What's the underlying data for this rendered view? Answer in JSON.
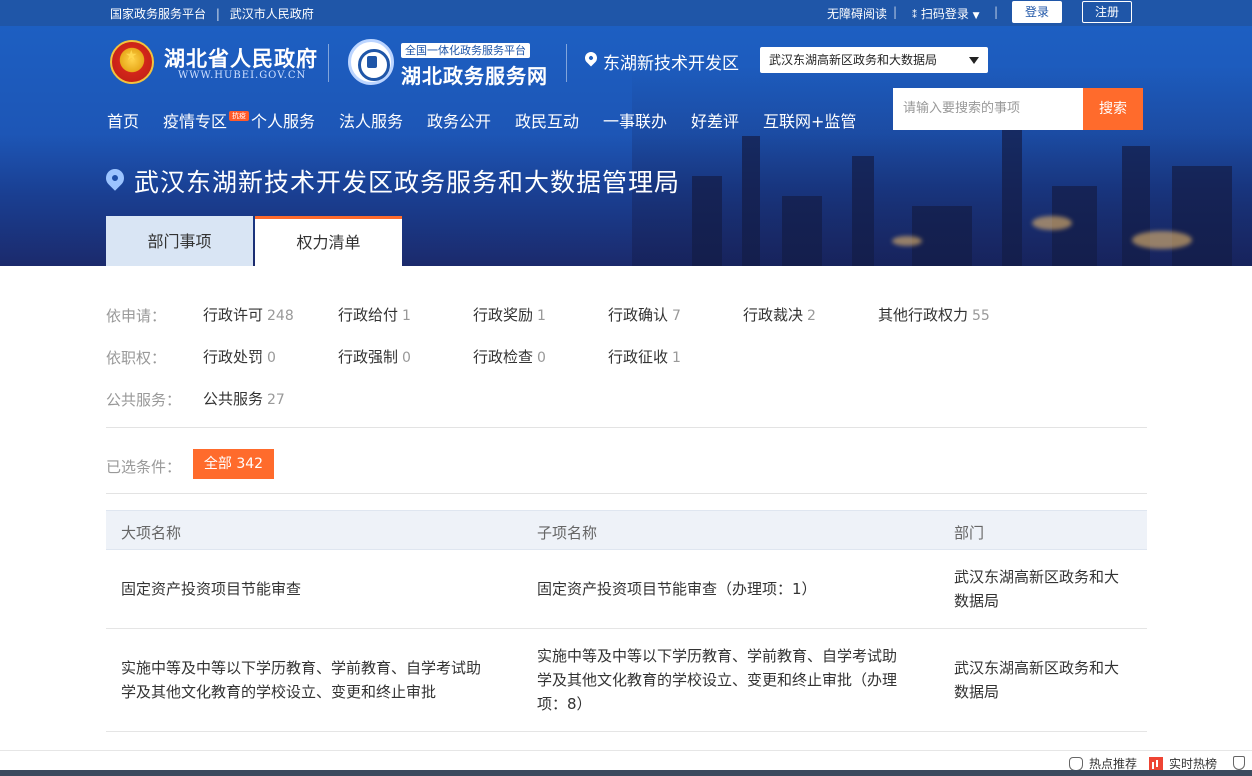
{
  "topbar": {
    "link1": "国家政务服务平台",
    "sep": "|",
    "link2": "武汉市人民政府",
    "accessible": "无障碍阅读",
    "qr_login": "扫码登录",
    "login": "登录",
    "register": "注册"
  },
  "header": {
    "gov_title": "湖北省人民政府",
    "gov_url": "WWW.HUBEI.GOV.CN",
    "svc_tag": "全国一体化政务服务平台",
    "svc_title": "湖北政务服务网",
    "location": "东湖新技术开发区",
    "dept_select": "武汉东湖高新区政务和大数据局",
    "search_placeholder": "请输入要搜索的事项",
    "search_button": "搜索"
  },
  "nav": {
    "items": [
      "首页",
      "疫情专区",
      "个人服务",
      "法人服务",
      "政务公开",
      "政民互动",
      "一事联办",
      "好差评",
      "互联网+监管"
    ],
    "badge": "抗疫"
  },
  "dept": {
    "title": "武汉东湖新技术开发区政务服务和大数据管理局",
    "tabs": [
      "部门事项",
      "权力清单"
    ]
  },
  "filters": {
    "groups": [
      {
        "label": "依申请：",
        "items": [
          {
            "name": "行政许可",
            "count": "248"
          },
          {
            "name": "行政给付",
            "count": "1"
          },
          {
            "name": "行政奖励",
            "count": "1"
          },
          {
            "name": "行政确认",
            "count": "7"
          },
          {
            "name": "行政裁决",
            "count": "2"
          },
          {
            "name": "其他行政权力",
            "count": "55"
          }
        ]
      },
      {
        "label": "依职权：",
        "items": [
          {
            "name": "行政处罚",
            "count": "0"
          },
          {
            "name": "行政强制",
            "count": "0"
          },
          {
            "name": "行政检查",
            "count": "0"
          },
          {
            "name": "行政征收",
            "count": "1"
          }
        ]
      },
      {
        "label": "公共服务：",
        "items": [
          {
            "name": "公共服务",
            "count": "27"
          }
        ]
      }
    ],
    "selected_label": "已选条件：",
    "selected_chip": "全部 342"
  },
  "table": {
    "headers": [
      "大项名称",
      "子项名称",
      "部门"
    ],
    "rows": [
      {
        "major": "固定资产投资项目节能审查",
        "sub": "固定资产投资项目节能审查（办理项：1）",
        "dept_l1": "武汉东湖高新区政务和大",
        "dept_l2": "数据局"
      },
      {
        "major_l1": "实施中等及中等以下学历教育、学前教育、自学考试助",
        "major_l2": "学及其他文化教育的学校设立、变更和终止审批",
        "sub_l1": "实施中等及中等以下学历教育、学前教育、自学考试助",
        "sub_l2": "学及其他文化教育的学校设立、变更和终止审批（办理",
        "sub_l3": "项：8）",
        "dept_l1": "武汉东湖高新区政务和大",
        "dept_l2": "数据局"
      }
    ]
  },
  "bottombar": {
    "hot_recommend": "热点推荐",
    "realtime_rank": "实时热榜"
  },
  "colors": {
    "primary_blue": "#1f56a8",
    "accent_orange": "#ff6b2c"
  }
}
